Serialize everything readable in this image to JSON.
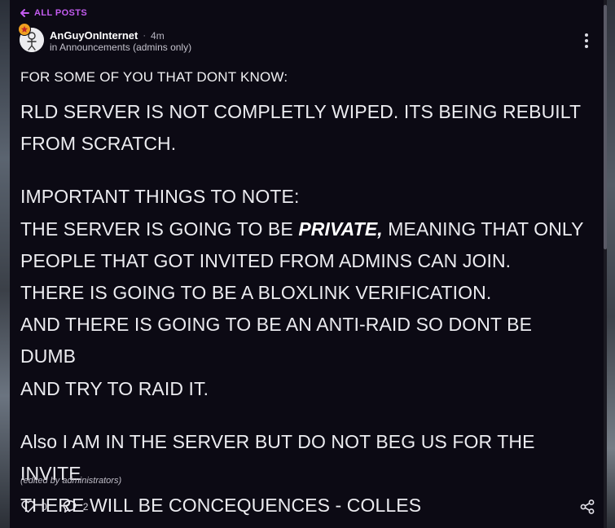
{
  "nav": {
    "back_label": "ALL POSTS"
  },
  "post": {
    "author": "AnGuyOnInternet",
    "separator": "·",
    "time": "4m",
    "channel": "in Announcements (admins only)",
    "intro": "FOR SOME OF YOU THAT DONT KNOW:",
    "line1a": "RLD SERVER IS NOT COMPLETLY WIPED. ITS BEING REBUILT",
    "line1b": "FROM SCRATCH.",
    "line2": "IMPORTANT THINGS TO NOTE:",
    "line3_pre": "THE SERVER IS GOING TO BE ",
    "line3_emph": "PRIVATE,",
    "line3_post": " MEANING THAT ONLY",
    "line4": "PEOPLE THAT GOT INVITED FROM ADMINS CAN JOIN.",
    "line5": "THERE IS GOING TO BE A BLOXLINK VERIFICATION.",
    "line6": "AND THERE IS GOING TO BE AN ANTI-RAID SO DONT BE DUMB",
    "line7": "AND TRY TO RAID IT.",
    "line8": "Also I AM IN THE SERVER BUT DO NOT BEG US FOR THE INVITE",
    "line9": "THERE WILL BE CONCEQUENCES  - COLLES",
    "edited": "(edited by administrators)"
  },
  "stats": {
    "likes": "0",
    "comments": "2"
  },
  "icons": {
    "back": "arrow-left-icon",
    "menu": "more-vertical-icon",
    "like": "heart-icon",
    "comment": "comment-icon",
    "share": "share-icon",
    "badge": "star-icon"
  },
  "colors": {
    "accent": "#c35cf0",
    "card_bg": "#0c0a14",
    "badge": "#f0a020"
  }
}
